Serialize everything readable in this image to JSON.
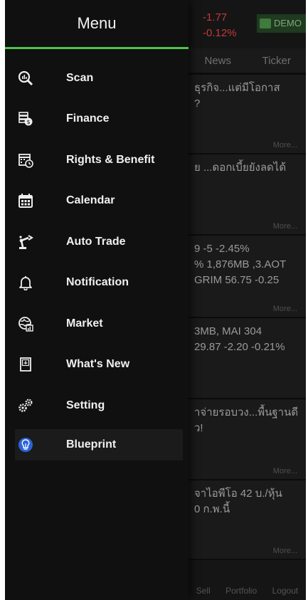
{
  "background": {
    "change_value": "-1.77",
    "change_percent": "-0.12%",
    "demo_label": "DEMO",
    "tabs": [
      "News",
      "Ticker"
    ],
    "cards": [
      {
        "lines": [
          "ธุรกิจ...แต่มีโอกาส",
          "?"
        ],
        "foot_right": "More..."
      },
      {
        "lines": [
          "ย ...ดอกเบี้ยยังลดได้"
        ],
        "foot_right": "More..."
      },
      {
        "lines": [
          "9 -5 -2.45%",
          "% 1,876MB ,3.AOT",
          "GRIM 56.75 -0.25"
        ],
        "foot_right": "More..."
      },
      {
        "lines": [
          "3MB, MAI 304",
          "29.87 -2.20 -0.21%"
        ],
        "foot_right": ""
      },
      {
        "lines": [
          "าจ่ายรอบวง...พื้นฐานดี",
          "ว!"
        ],
        "foot_right": "More..."
      },
      {
        "lines": [
          "จาไอพีโอ 42 บ./หุ้น",
          "0 ก.พ.นี้"
        ],
        "foot_right": "More..."
      }
    ],
    "bottom_nav": [
      "Sell",
      "Portfolio",
      "Logout"
    ]
  },
  "menu": {
    "title": "Menu",
    "accent": "#4fc34c",
    "items": [
      {
        "label": "Scan",
        "icon": "scan-icon"
      },
      {
        "label": "Finance",
        "icon": "finance-icon"
      },
      {
        "label": "Rights & Benefit",
        "icon": "rights-benefit-icon"
      },
      {
        "label": "Calendar",
        "icon": "calendar-icon"
      },
      {
        "label": "Auto Trade",
        "icon": "robot-arm-icon"
      },
      {
        "label": "Notification",
        "icon": "bell-icon"
      },
      {
        "label": "Market",
        "icon": "market-icon"
      },
      {
        "label": "What's New",
        "icon": "whats-new-icon"
      },
      {
        "label": "Setting",
        "icon": "gears-icon"
      },
      {
        "label": "Blueprint",
        "icon": "lightbulb-icon"
      }
    ]
  }
}
